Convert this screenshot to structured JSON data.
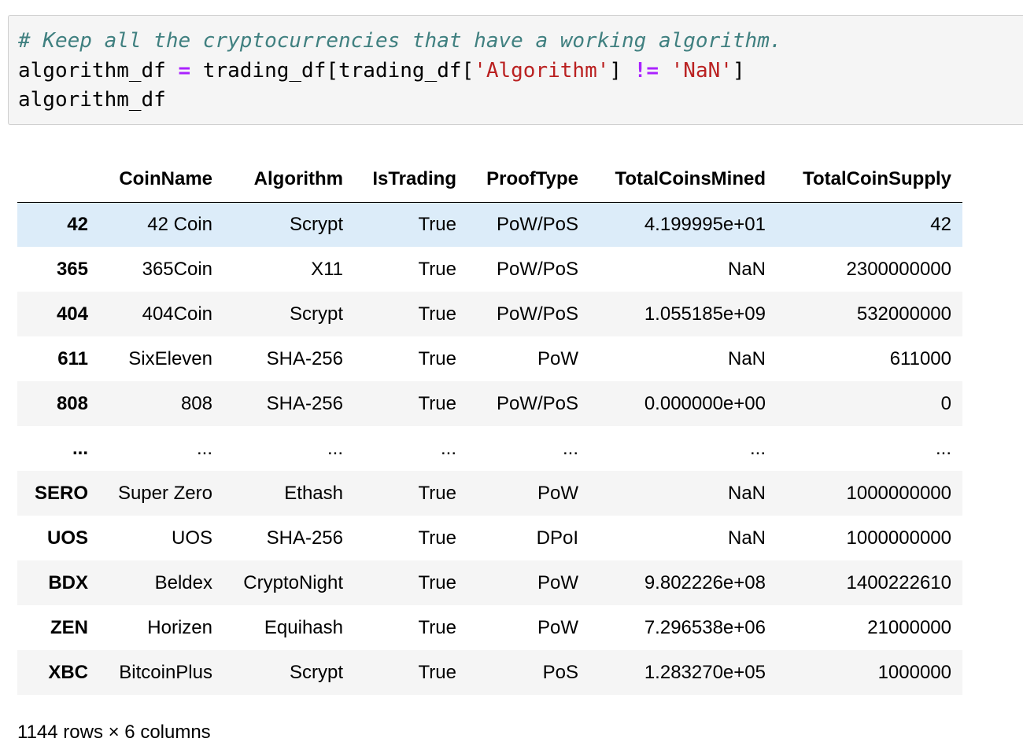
{
  "code": {
    "comment": "# Keep all the cryptocurrencies that have a working algorithm.",
    "line2": {
      "var": "algorithm_df ",
      "assign": "=",
      "expr1": " trading_df[trading_df[",
      "str1": "'Algorithm'",
      "expr2": "] ",
      "neq": "!=",
      "space": " ",
      "str2": "'NaN'",
      "expr3": "]"
    },
    "line3": "algorithm_df"
  },
  "table": {
    "columns": [
      "",
      "CoinName",
      "Algorithm",
      "IsTrading",
      "ProofType",
      "TotalCoinsMined",
      "TotalCoinSupply"
    ],
    "rows": [
      {
        "index": "42",
        "cells": [
          "42 Coin",
          "Scrypt",
          "True",
          "PoW/PoS",
          "4.199995e+01",
          "42"
        ]
      },
      {
        "index": "365",
        "cells": [
          "365Coin",
          "X11",
          "True",
          "PoW/PoS",
          "NaN",
          "2300000000"
        ]
      },
      {
        "index": "404",
        "cells": [
          "404Coin",
          "Scrypt",
          "True",
          "PoW/PoS",
          "1.055185e+09",
          "532000000"
        ]
      },
      {
        "index": "611",
        "cells": [
          "SixEleven",
          "SHA-256",
          "True",
          "PoW",
          "NaN",
          "611000"
        ]
      },
      {
        "index": "808",
        "cells": [
          "808",
          "SHA-256",
          "True",
          "PoW/PoS",
          "0.000000e+00",
          "0"
        ]
      },
      {
        "index": "...",
        "cells": [
          "...",
          "...",
          "...",
          "...",
          "...",
          "..."
        ]
      },
      {
        "index": "SERO",
        "cells": [
          "Super Zero",
          "Ethash",
          "True",
          "PoW",
          "NaN",
          "1000000000"
        ]
      },
      {
        "index": "UOS",
        "cells": [
          "UOS",
          "SHA-256",
          "True",
          "DPoI",
          "NaN",
          "1000000000"
        ]
      },
      {
        "index": "BDX",
        "cells": [
          "Beldex",
          "CryptoNight",
          "True",
          "PoW",
          "9.802226e+08",
          "1400222610"
        ]
      },
      {
        "index": "ZEN",
        "cells": [
          "Horizen",
          "Equihash",
          "True",
          "PoW",
          "7.296538e+06",
          "21000000"
        ]
      },
      {
        "index": "XBC",
        "cells": [
          "BitcoinPlus",
          "Scrypt",
          "True",
          "PoS",
          "1.283270e+05",
          "1000000"
        ]
      }
    ],
    "hover_row": 0
  },
  "footer": "1144 rows × 6 columns"
}
